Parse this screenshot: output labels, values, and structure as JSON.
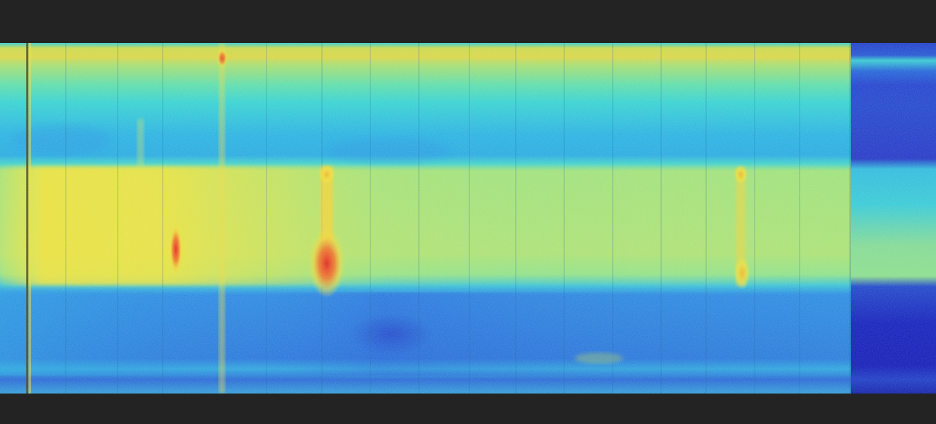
{
  "image": {
    "kind": "thermal-heatmap-strip",
    "colormap": "jet",
    "background_color": "#232323",
    "palette": {
      "cold": "#0a14c8",
      "cool": "#1e6ee6",
      "mid": "#28c8dc",
      "warm": "#96e678",
      "hot": "#f0e632",
      "hottest": "#e83218"
    },
    "visible_text": []
  }
}
